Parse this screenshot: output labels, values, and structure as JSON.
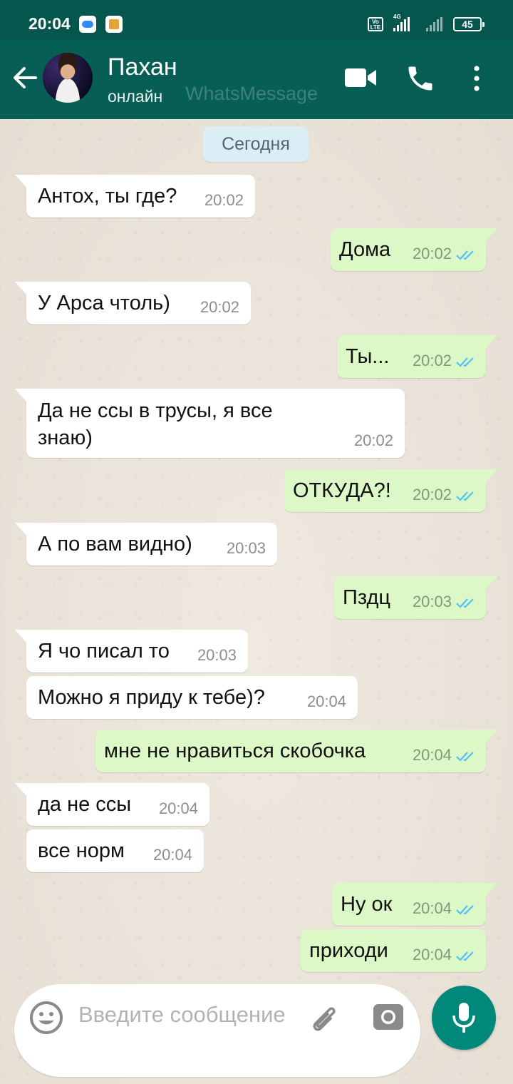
{
  "status_bar": {
    "time": "20:04",
    "battery": "45",
    "network": "4G",
    "volte": "Vo LTE"
  },
  "header": {
    "contact_name": "Пахан",
    "contact_status": "онлайн",
    "watermark": "WhatsMessage"
  },
  "chat": {
    "date_label": "Сегодня",
    "messages": [
      {
        "direction": "in",
        "text": "Антох, ты где?",
        "time": "20:02"
      },
      {
        "direction": "out",
        "text": "Дома",
        "time": "20:02",
        "read": true
      },
      {
        "direction": "in",
        "text": "У Арса чтоль)",
        "time": "20:02"
      },
      {
        "direction": "out",
        "text": "Ты...",
        "time": "20:02",
        "read": true
      },
      {
        "direction": "in",
        "text": "Да не ссы в трусы, я все знаю)",
        "time": "20:02"
      },
      {
        "direction": "out",
        "text": "ОТКУДА?!",
        "time": "20:02",
        "read": true
      },
      {
        "direction": "in",
        "text": "А по вам видно)",
        "time": "20:03"
      },
      {
        "direction": "out",
        "text": "Пздц",
        "time": "20:03",
        "read": true
      },
      {
        "direction": "in",
        "text": "Я чо писал то",
        "time": "20:03"
      },
      {
        "direction": "in",
        "text": "Можно я приду к тебе)?",
        "time": "20:04"
      },
      {
        "direction": "out",
        "text": "мне не нравиться скобочка",
        "time": "20:04",
        "read": true
      },
      {
        "direction": "in",
        "text": "да не ссы",
        "time": "20:04"
      },
      {
        "direction": "in",
        "text": "все норм",
        "time": "20:04"
      },
      {
        "direction": "out",
        "text": "Ну ок",
        "time": "20:04",
        "read": true
      },
      {
        "direction": "out",
        "text": "приходи",
        "time": "20:04",
        "read": true
      }
    ]
  },
  "input": {
    "placeholder": "Введите сообщение",
    "value": ""
  },
  "colors": {
    "header": "#075e54",
    "status_bar": "#05564d",
    "outgoing_bubble": "#dcf8c6",
    "incoming_bubble": "#ffffff",
    "read_ticks": "#4fc3f7",
    "mic_button": "#00897b"
  },
  "icons": [
    "back-arrow-icon",
    "video-call-icon",
    "phone-icon",
    "more-vert-icon",
    "emoji-icon",
    "attach-icon",
    "camera-icon",
    "mic-icon",
    "double-check-icon"
  ]
}
